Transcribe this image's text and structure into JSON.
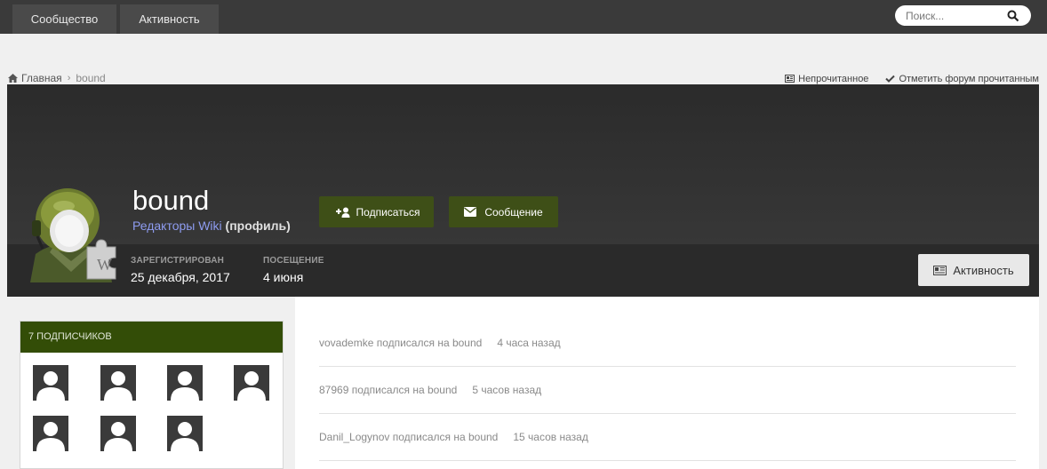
{
  "nav": {
    "tabs": [
      "Сообщество",
      "Активность"
    ],
    "search_placeholder": "Поиск..."
  },
  "breadcrumb": {
    "home": "Главная",
    "current": "bound"
  },
  "top_links": {
    "unread": "Непрочитанное",
    "mark_read": "Отметить форум прочитанным"
  },
  "profile": {
    "username": "bound",
    "group": "Редакторы Wiki",
    "profile_link": "(профиль)",
    "follow_label": "Подписаться",
    "message_label": "Сообщение",
    "registered_label": "ЗАРЕГИСТРИРОВАН",
    "registered_value": "25 декабря, 2017",
    "visit_label": "ПОСЕЩЕНИЕ",
    "visit_value": "4 июня",
    "activity_label": "Активность"
  },
  "followers": {
    "title": "7 ПОДПИСЧИКОВ",
    "count": 7
  },
  "feed": [
    {
      "text": "vovademke подписался на bound",
      "time": "4 часа назад"
    },
    {
      "text": "87969 подписался на bound",
      "time": "5 часов назад"
    },
    {
      "text": "Danil_Logynov подписался на bound",
      "time": "15 часов назад"
    }
  ],
  "colors": {
    "accent_green": "#3e4f17",
    "header_green": "#334d07",
    "topbar": "#3a3a3a"
  }
}
